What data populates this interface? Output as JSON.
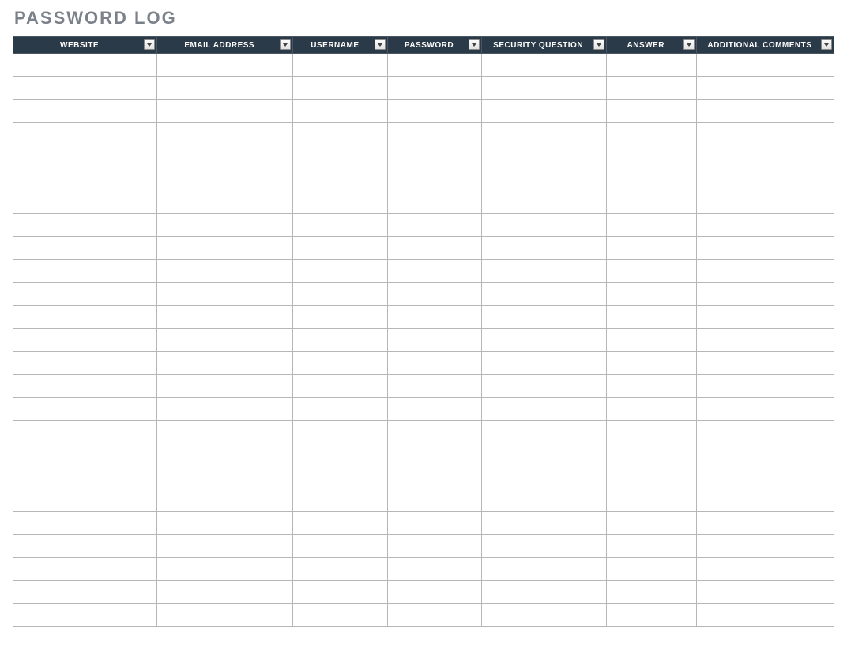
{
  "title": "PASSWORD LOG",
  "columns": [
    {
      "key": "website",
      "label": "WEBSITE",
      "shade": "c-white"
    },
    {
      "key": "email",
      "label": "EMAIL ADDRESS",
      "shade": "c-grey"
    },
    {
      "key": "username",
      "label": "USERNAME",
      "shade": "c-blue"
    },
    {
      "key": "password",
      "label": "PASSWORD",
      "shade": "c-blue"
    },
    {
      "key": "secq",
      "label": "SECURITY QUESTION",
      "shade": "c-grey"
    },
    {
      "key": "answer",
      "label": "ANSWER",
      "shade": "c-grey"
    },
    {
      "key": "comments",
      "label": "ADDITIONAL COMMENTS",
      "shade": "c-white"
    }
  ],
  "row_count": 25,
  "rows": [
    [
      "",
      "",
      "",
      "",
      "",
      "",
      ""
    ],
    [
      "",
      "",
      "",
      "",
      "",
      "",
      ""
    ],
    [
      "",
      "",
      "",
      "",
      "",
      "",
      ""
    ],
    [
      "",
      "",
      "",
      "",
      "",
      "",
      ""
    ],
    [
      "",
      "",
      "",
      "",
      "",
      "",
      ""
    ],
    [
      "",
      "",
      "",
      "",
      "",
      "",
      ""
    ],
    [
      "",
      "",
      "",
      "",
      "",
      "",
      ""
    ],
    [
      "",
      "",
      "",
      "",
      "",
      "",
      ""
    ],
    [
      "",
      "",
      "",
      "",
      "",
      "",
      ""
    ],
    [
      "",
      "",
      "",
      "",
      "",
      "",
      ""
    ],
    [
      "",
      "",
      "",
      "",
      "",
      "",
      ""
    ],
    [
      "",
      "",
      "",
      "",
      "",
      "",
      ""
    ],
    [
      "",
      "",
      "",
      "",
      "",
      "",
      ""
    ],
    [
      "",
      "",
      "",
      "",
      "",
      "",
      ""
    ],
    [
      "",
      "",
      "",
      "",
      "",
      "",
      ""
    ],
    [
      "",
      "",
      "",
      "",
      "",
      "",
      ""
    ],
    [
      "",
      "",
      "",
      "",
      "",
      "",
      ""
    ],
    [
      "",
      "",
      "",
      "",
      "",
      "",
      ""
    ],
    [
      "",
      "",
      "",
      "",
      "",
      "",
      ""
    ],
    [
      "",
      "",
      "",
      "",
      "",
      "",
      ""
    ],
    [
      "",
      "",
      "",
      "",
      "",
      "",
      ""
    ],
    [
      "",
      "",
      "",
      "",
      "",
      "",
      ""
    ],
    [
      "",
      "",
      "",
      "",
      "",
      "",
      ""
    ],
    [
      "",
      "",
      "",
      "",
      "",
      "",
      ""
    ],
    [
      "",
      "",
      "",
      "",
      "",
      "",
      ""
    ]
  ],
  "colors": {
    "header_bg": "#2b3a48",
    "title_color": "#7b8189",
    "grey_fill": "#ececec",
    "blue_fill": "#dde4ee"
  }
}
